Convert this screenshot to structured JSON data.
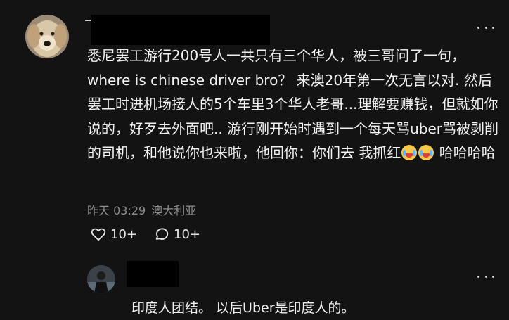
{
  "comment": {
    "author_avatar": "golden-retriever-avatar",
    "text": "悉尼罢工游行200号人一共只有三个华人，被三哥问了一句，where is chinese driver bro？ 来澳20年第一次无言以对. 然后罢工时进机场接人的5个车里3个华人老哥...理解要赚钱，但就如你说的，好歹去外面吧.. 游行刚开始时遇到一个每天骂uber骂被剥削的司机，和他说你也来啦，他回你：你们去 我抓红",
    "text_tail": "哈哈哈哈",
    "emojis": [
      "crying-face-emoji",
      "crying-face-emoji"
    ],
    "timestamp": "昨天 03:29",
    "location": "澳大利亚",
    "like_count": "10+",
    "reply_count": "10+"
  },
  "reply": {
    "author_avatar": "person-photo-avatar",
    "text": "印度人团结。 以后Uber是印度人的。"
  },
  "colors": {
    "background": "#131313",
    "text": "#f2f2f2",
    "meta": "#8e8e8e"
  }
}
